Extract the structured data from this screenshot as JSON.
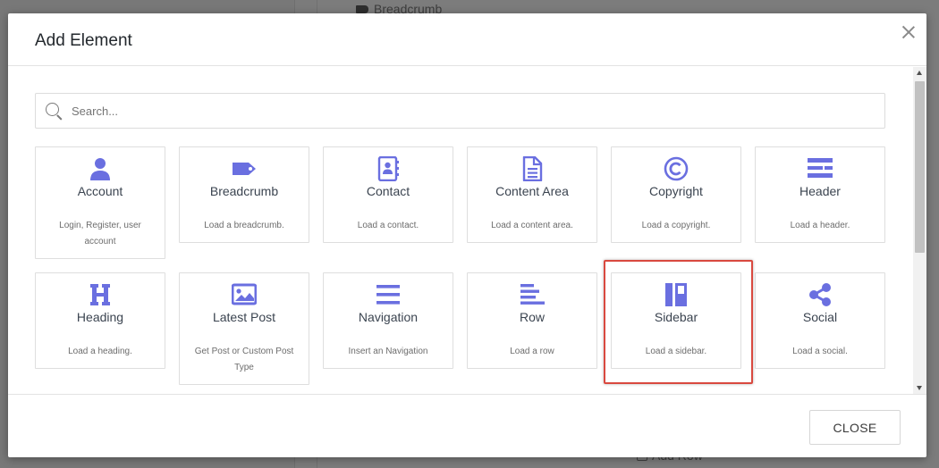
{
  "background": {
    "breadcrumb_label": "Breadcrumb",
    "add_row_label": "Add Row"
  },
  "modal": {
    "title": "Add Element",
    "search_placeholder": "Search...",
    "close_label": "CLOSE",
    "highlighted_element": "Sidebar",
    "accent_color": "#6a6fe0",
    "highlight_color": "#d9493f",
    "elements": [
      {
        "title": "Account",
        "description": "Login, Register, user account",
        "icon": "user-icon"
      },
      {
        "title": "Breadcrumb",
        "description": "Load a breadcrumb.",
        "icon": "tag-icon"
      },
      {
        "title": "Contact",
        "description": "Load a contact.",
        "icon": "contact-book-icon"
      },
      {
        "title": "Content Area",
        "description": "Load a content area.",
        "icon": "document-icon"
      },
      {
        "title": "Copyright",
        "description": "Load a copyright.",
        "icon": "copyright-icon"
      },
      {
        "title": "Header",
        "description": "Load a header.",
        "icon": "header-layout-icon"
      },
      {
        "title": "Heading",
        "description": "Load a heading.",
        "icon": "heading-h-icon"
      },
      {
        "title": "Latest Post",
        "description": "Get Post or Custom Post Type",
        "icon": "image-icon"
      },
      {
        "title": "Navigation",
        "description": "Insert an Navigation",
        "icon": "menu-bars-icon"
      },
      {
        "title": "Row",
        "description": "Load a row",
        "icon": "align-left-icon"
      },
      {
        "title": "Sidebar",
        "description": "Load a sidebar.",
        "icon": "sidebar-layout-icon"
      },
      {
        "title": "Social",
        "description": "Load a social.",
        "icon": "share-icon"
      }
    ]
  }
}
